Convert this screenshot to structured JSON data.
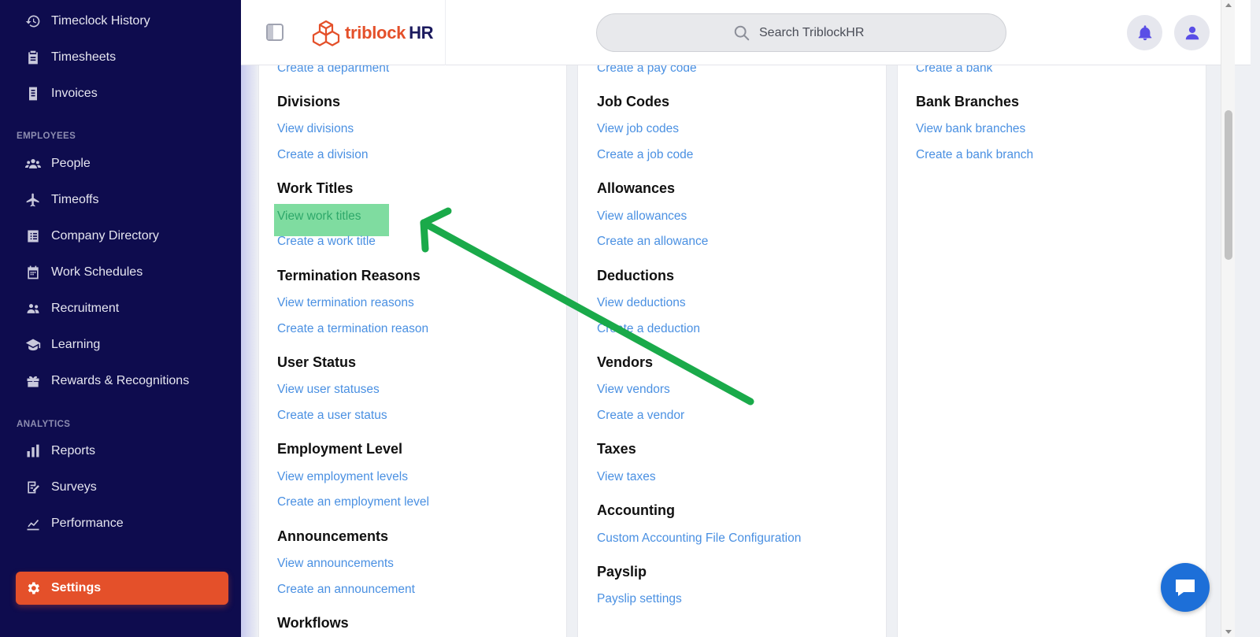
{
  "sidebar": {
    "items_top": [
      {
        "label": "Timeclock History",
        "icon": "timeclock-history-icon"
      },
      {
        "label": "Timesheets",
        "icon": "timesheets-icon"
      },
      {
        "label": "Invoices",
        "icon": "invoices-icon"
      }
    ],
    "section_employees": "EMPLOYEES",
    "items_employees": [
      {
        "label": "People",
        "icon": "people-icon"
      },
      {
        "label": "Timeoffs",
        "icon": "plane-icon"
      },
      {
        "label": "Company Directory",
        "icon": "directory-icon"
      },
      {
        "label": "Work Schedules",
        "icon": "calendar-icon"
      },
      {
        "label": "Recruitment",
        "icon": "recruitment-icon"
      },
      {
        "label": "Learning",
        "icon": "graduation-cap-icon"
      },
      {
        "label": "Rewards & Recognitions",
        "icon": "gift-icon"
      }
    ],
    "section_analytics": "ANALYTICS",
    "items_analytics": [
      {
        "label": "Reports",
        "icon": "bar-chart-icon"
      },
      {
        "label": "Surveys",
        "icon": "survey-icon"
      },
      {
        "label": "Performance",
        "icon": "line-chart-icon"
      }
    ],
    "settings_label": "Settings"
  },
  "header": {
    "logo_text": "triblock",
    "logo_suffix": "HR",
    "search_placeholder": "Search TriblockHR"
  },
  "col1": {
    "top_link": "Create a department",
    "sections": [
      {
        "title": "Divisions",
        "links": [
          "View divisions",
          "Create a division"
        ]
      },
      {
        "title": "Work Titles",
        "links": [
          "View work titles",
          "Create a work title"
        ]
      },
      {
        "title": "Termination Reasons",
        "links": [
          "View termination reasons",
          "Create a termination reason"
        ]
      },
      {
        "title": "User Status",
        "links": [
          "View user statuses",
          "Create a user status"
        ]
      },
      {
        "title": "Employment Level",
        "links": [
          "View employment levels",
          "Create an employment level"
        ]
      },
      {
        "title": "Announcements",
        "links": [
          "View announcements",
          "Create an announcement"
        ]
      },
      {
        "title": "Workflows",
        "links": []
      }
    ]
  },
  "col2": {
    "top_link": "Create a pay code",
    "sections": [
      {
        "title": "Job Codes",
        "links": [
          "View job codes",
          "Create a job code"
        ]
      },
      {
        "title": "Allowances",
        "links": [
          "View allowances",
          "Create an allowance"
        ]
      },
      {
        "title": "Deductions",
        "links": [
          "View deductions",
          "Create a deduction"
        ]
      },
      {
        "title": "Vendors",
        "links": [
          "View vendors",
          "Create a vendor"
        ]
      },
      {
        "title": "Taxes",
        "links": [
          "View taxes"
        ]
      },
      {
        "title": "Accounting",
        "links": [
          "Custom Accounting File Configuration"
        ]
      },
      {
        "title": "Payslip",
        "links": [
          "Payslip settings"
        ]
      }
    ]
  },
  "col3": {
    "top_link": "Create a bank",
    "sections": [
      {
        "title": "Bank Branches",
        "links": [
          "View bank branches",
          "Create a bank branch"
        ]
      }
    ]
  },
  "colors": {
    "sidebar_bg": "#0e0c4e",
    "accent": "#e4502a",
    "link": "#4a90e2",
    "highlight": "#7fdca0",
    "arrow": "#1aaa4a"
  }
}
